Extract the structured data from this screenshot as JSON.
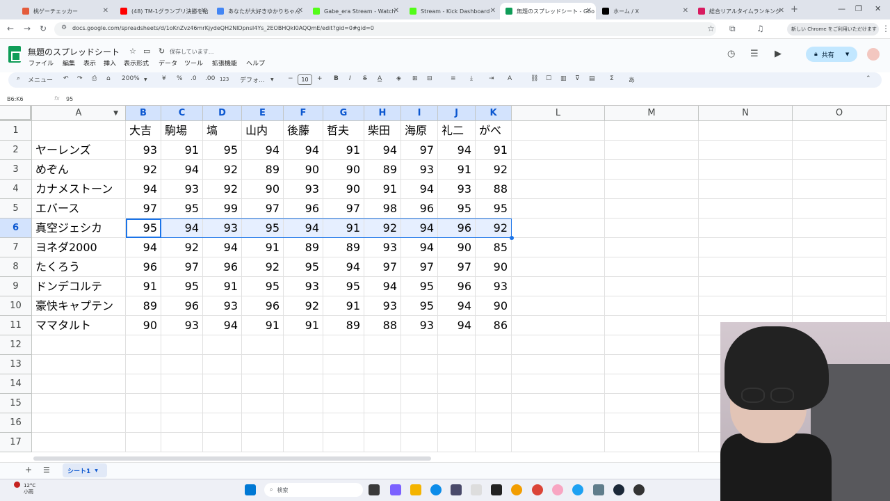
{
  "browser": {
    "tabs": [
      {
        "label": "桃ゲーチェッカー",
        "favicon": "#e45b3b"
      },
      {
        "label": "(48) TM-1グランプリ決勝を給",
        "favicon": "#ff0000"
      },
      {
        "label": "あなたが大好きゆかりちゃん",
        "favicon": "#4285f4"
      },
      {
        "label": "Gabe_era Stream - Watch",
        "favicon": "#53fc18"
      },
      {
        "label": "Stream - Kick Dashboard",
        "favicon": "#53fc18"
      },
      {
        "label": "無題のスプレッドシート - Goo",
        "favicon": "#0f9d58"
      },
      {
        "label": "ホーム / X",
        "favicon": "#000000"
      },
      {
        "label": "総合リアルタイムランキング",
        "favicon": "#d81b60"
      }
    ],
    "url": "docs.google.com/spreadsheets/d/1oKnZvz46mrKjydeQH2NlDpnsI4Ys_2EOBHQkI0AQQmE/edit?gid=0#gid=0",
    "chrome_banner": "新しい Chrome をご利用いただけます"
  },
  "app": {
    "title": "無題のスプレッドシート",
    "saving_status": "保存しています...",
    "menus": [
      "ファイル",
      "編集",
      "表示",
      "挿入",
      "表示形式",
      "データ",
      "ツール",
      "拡張機能",
      "ヘルプ"
    ],
    "share_label": "共有"
  },
  "toolbar": {
    "menu_search": "メニュー",
    "zoom": "200%",
    "currency": "¥",
    "percent": "%",
    "dec_decrease": ".0",
    "dec_increase": ".00",
    "format_123": "123",
    "font": "デフォ...",
    "font_size": "10"
  },
  "formula_bar": {
    "name_box": "B6:K6",
    "value": "95"
  },
  "sheet": {
    "columns": [
      "A",
      "B",
      "C",
      "D",
      "E",
      "F",
      "G",
      "H",
      "I",
      "J",
      "K",
      "L",
      "M",
      "N",
      "O"
    ],
    "rows": [
      "1",
      "2",
      "3",
      "4",
      "5",
      "6",
      "7",
      "8",
      "9",
      "10",
      "11",
      "12",
      "13",
      "14",
      "15",
      "16",
      "17"
    ],
    "header_row": [
      "",
      "大吉",
      "駒場",
      "塙",
      "山内",
      "後藤",
      "哲夫",
      "柴田",
      "海原",
      "礼二",
      "がべ"
    ],
    "data": [
      [
        "ヤーレンズ",
        "93",
        "91",
        "95",
        "94",
        "94",
        "91",
        "94",
        "97",
        "94",
        "91"
      ],
      [
        "めぞん",
        "92",
        "94",
        "92",
        "89",
        "90",
        "90",
        "89",
        "93",
        "91",
        "92"
      ],
      [
        "カナメストーン",
        "94",
        "93",
        "92",
        "90",
        "93",
        "90",
        "91",
        "94",
        "93",
        "88"
      ],
      [
        "エバース",
        "97",
        "95",
        "99",
        "97",
        "96",
        "97",
        "98",
        "96",
        "95",
        "95"
      ],
      [
        "真空ジェシカ",
        "95",
        "94",
        "93",
        "95",
        "94",
        "91",
        "92",
        "94",
        "96",
        "92"
      ],
      [
        "ヨネダ2000",
        "94",
        "92",
        "94",
        "91",
        "89",
        "89",
        "93",
        "94",
        "90",
        "85"
      ],
      [
        "たくろう",
        "96",
        "97",
        "96",
        "92",
        "95",
        "94",
        "97",
        "97",
        "97",
        "90"
      ],
      [
        "ドンデコルテ",
        "91",
        "95",
        "91",
        "95",
        "93",
        "95",
        "94",
        "95",
        "96",
        "93"
      ],
      [
        "豪快キャプテン",
        "89",
        "96",
        "93",
        "96",
        "92",
        "91",
        "93",
        "95",
        "94",
        "90"
      ],
      [
        "ママタルト",
        "90",
        "93",
        "94",
        "91",
        "91",
        "89",
        "88",
        "93",
        "94",
        "86"
      ]
    ],
    "selection": {
      "range": "B6:K6",
      "row": 6
    }
  },
  "sheet_tabs": {
    "active": "シート1"
  },
  "taskbar": {
    "weather_temp": "12°C",
    "weather_desc": "小雨",
    "search_label": "検索"
  }
}
